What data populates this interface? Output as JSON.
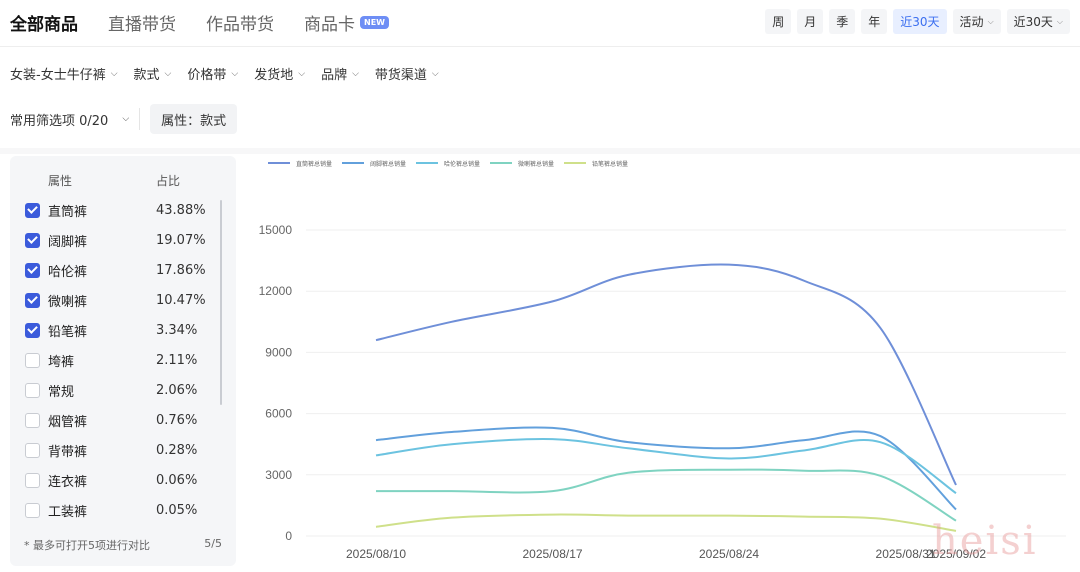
{
  "tabs": [
    {
      "label": "全部商品",
      "active": true
    },
    {
      "label": "直播带货",
      "active": false
    },
    {
      "label": "作品带货",
      "active": false
    },
    {
      "label": "商品卡",
      "active": false,
      "badge": "NEW"
    }
  ],
  "periods": [
    {
      "label": "周",
      "selected": false,
      "dropdown": false
    },
    {
      "label": "月",
      "selected": false,
      "dropdown": false
    },
    {
      "label": "季",
      "selected": false,
      "dropdown": false
    },
    {
      "label": "年",
      "selected": false,
      "dropdown": false
    },
    {
      "label": "近30天",
      "selected": true,
      "dropdown": false
    },
    {
      "label": "活动",
      "selected": false,
      "dropdown": true
    },
    {
      "label": "近30天",
      "selected": false,
      "dropdown": true
    }
  ],
  "filters": [
    "女装-女士牛仔裤",
    "款式",
    "价格带",
    "发货地",
    "品牌",
    "带货渠道"
  ],
  "common": {
    "label": "常用筛选项 0/20",
    "attr_chip": "属性：款式"
  },
  "panel": {
    "header_attr": "属性",
    "header_pct": "占比",
    "rows": [
      {
        "name": "直筒裤",
        "pct": "43.88%",
        "checked": true
      },
      {
        "name": "阔脚裤",
        "pct": "19.07%",
        "checked": true
      },
      {
        "name": "哈伦裤",
        "pct": "17.86%",
        "checked": true
      },
      {
        "name": "微喇裤",
        "pct": "10.47%",
        "checked": true
      },
      {
        "name": "铅笔裤",
        "pct": "3.34%",
        "checked": true
      },
      {
        "name": "垮裤",
        "pct": "2.11%",
        "checked": false
      },
      {
        "name": "常规",
        "pct": "2.06%",
        "checked": false
      },
      {
        "name": "烟管裤",
        "pct": "0.76%",
        "checked": false
      },
      {
        "name": "背带裤",
        "pct": "0.28%",
        "checked": false
      },
      {
        "name": "连衣裤",
        "pct": "0.06%",
        "checked": false
      },
      {
        "name": "工装裤",
        "pct": "0.05%",
        "checked": false
      }
    ],
    "footer_note": "* 最多可打开5项进行对比",
    "footer_count": "5/5"
  },
  "chart_data": {
    "type": "line",
    "x": [
      "2025/08/10",
      "2025/08/17",
      "2025/08/24",
      "2025/08/31",
      "2025/09/02"
    ],
    "x_days": [
      0,
      7,
      14,
      21,
      23
    ],
    "ylim": [
      0,
      15000
    ],
    "yticks": [
      0,
      3000,
      6000,
      9000,
      12000,
      15000
    ],
    "grid": true,
    "legend_position": "top-left",
    "series": [
      {
        "name": "直筒裤总销量",
        "color": "#6f8fd8",
        "points": [
          [
            0,
            9600
          ],
          [
            3,
            10500
          ],
          [
            7,
            11500
          ],
          [
            10,
            12800
          ],
          [
            14,
            13300
          ],
          [
            17,
            12500
          ],
          [
            20,
            10200
          ],
          [
            23,
            2500
          ]
        ]
      },
      {
        "name": "阔脚裤总销量",
        "color": "#62a0dc",
        "points": [
          [
            0,
            4700
          ],
          [
            3,
            5100
          ],
          [
            7,
            5300
          ],
          [
            10,
            4600
          ],
          [
            14,
            4300
          ],
          [
            17,
            4700
          ],
          [
            20,
            4900
          ],
          [
            23,
            1300
          ]
        ]
      },
      {
        "name": "哈伦裤总销量",
        "color": "#6cc3e0",
        "points": [
          [
            0,
            3950
          ],
          [
            3,
            4500
          ],
          [
            7,
            4750
          ],
          [
            10,
            4300
          ],
          [
            14,
            3800
          ],
          [
            17,
            4200
          ],
          [
            20,
            4600
          ],
          [
            23,
            2100
          ]
        ]
      },
      {
        "name": "微喇裤总销量",
        "color": "#7fd3c1",
        "points": [
          [
            0,
            2200
          ],
          [
            3,
            2200
          ],
          [
            7,
            2200
          ],
          [
            10,
            3100
          ],
          [
            14,
            3250
          ],
          [
            17,
            3200
          ],
          [
            20,
            2950
          ],
          [
            23,
            750
          ]
        ]
      },
      {
        "name": "铅笔裤总销量",
        "color": "#cfe08a",
        "points": [
          [
            0,
            450
          ],
          [
            3,
            900
          ],
          [
            7,
            1050
          ],
          [
            10,
            1000
          ],
          [
            14,
            1000
          ],
          [
            17,
            950
          ],
          [
            20,
            850
          ],
          [
            23,
            250
          ]
        ]
      }
    ]
  },
  "watermark": "heisi"
}
